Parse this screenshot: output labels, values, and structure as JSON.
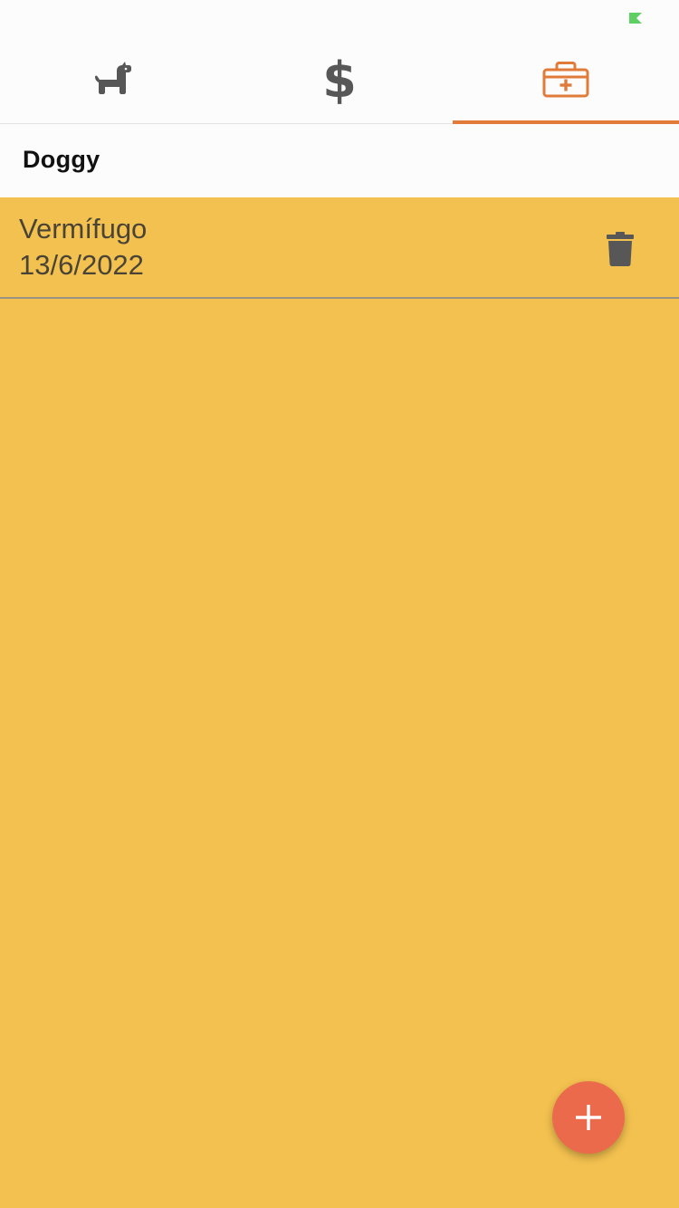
{
  "colors": {
    "background": "#f3c14f",
    "tab_bar": "#fcfcfc",
    "tab_icon_inactive": "#575757",
    "tab_icon_active": "#e07b39",
    "tab_indicator": "#e07b39",
    "item_text": "#4a4436",
    "delete_icon": "#575757",
    "fab": "#ec6a4c",
    "fab_icon": "#ffffff",
    "battery": "#5fce63"
  },
  "status_bar": {
    "battery_icon": "battery-icon"
  },
  "tabs": [
    {
      "icon": "dog-icon",
      "active": false
    },
    {
      "icon": "dollar-icon",
      "active": false
    },
    {
      "icon": "medical-kit-icon",
      "active": true
    }
  ],
  "header": {
    "title": "Doggy"
  },
  "items": [
    {
      "title": "Vermífugo",
      "date": "13/6/2022",
      "action_icon": "trash-icon"
    }
  ],
  "fab": {
    "icon": "plus-icon"
  }
}
